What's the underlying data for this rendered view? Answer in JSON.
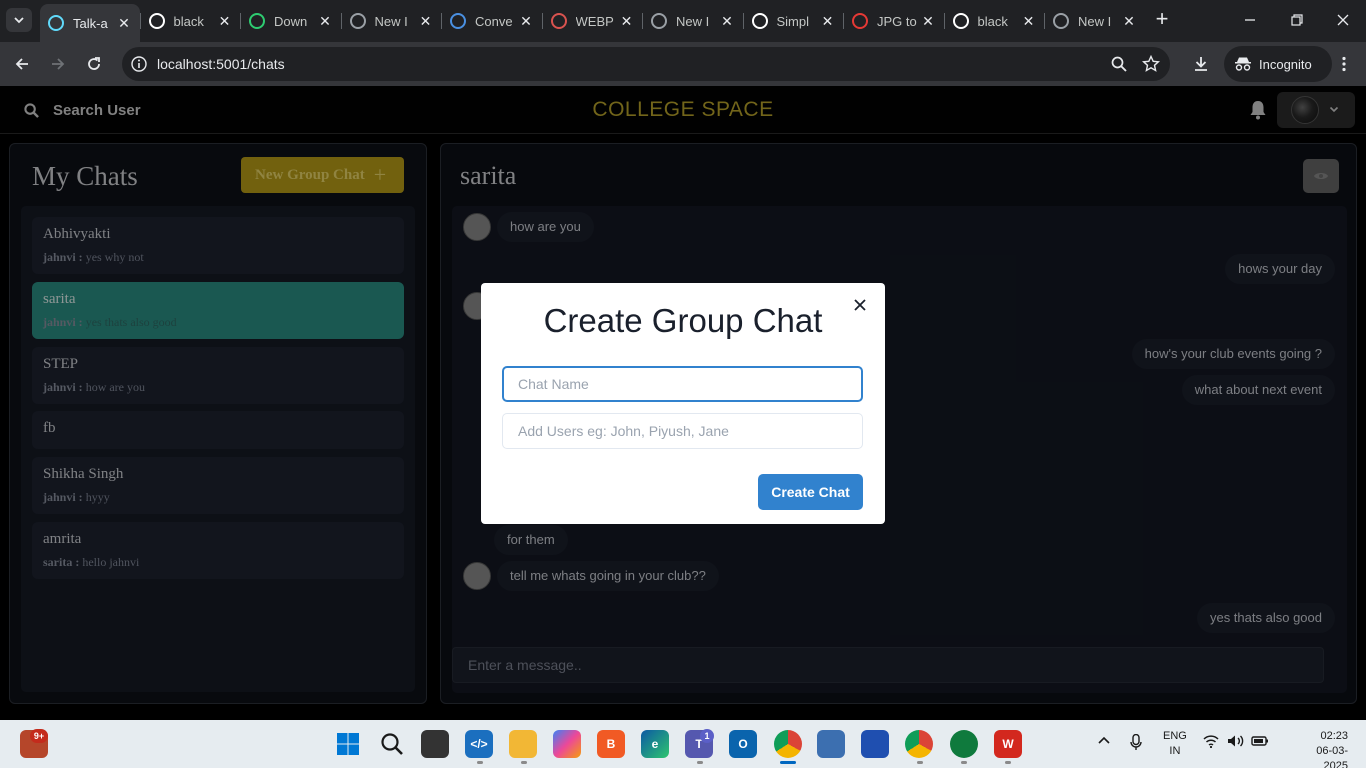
{
  "browser": {
    "tabs": [
      {
        "title": "Talk-a",
        "icon": "react-icon",
        "color": "#61dafb"
      },
      {
        "title": "black",
        "icon": "google-icon",
        "color": "#ffffff"
      },
      {
        "title": "Down",
        "icon": "px-icon",
        "color": "#2ecc71"
      },
      {
        "title": "New I",
        "icon": "incognito-icon",
        "color": "#9aa0a6"
      },
      {
        "title": "Conve",
        "icon": "diamond-icon",
        "color": "#4a90e2"
      },
      {
        "title": "WEBP",
        "icon": "cloud-icon",
        "color": "#d9534f"
      },
      {
        "title": "New I",
        "icon": "incognito-icon",
        "color": "#9aa0a6"
      },
      {
        "title": "Simpl",
        "icon": "google-icon",
        "color": "#ffffff"
      },
      {
        "title": "JPG to",
        "icon": "jpg-png-icon",
        "color": "#e53935"
      },
      {
        "title": "black",
        "icon": "google-icon",
        "color": "#ffffff"
      },
      {
        "title": "New I",
        "icon": "incognito-icon",
        "color": "#9aa0a6"
      }
    ],
    "url": "localhost:5001/chats",
    "incognito_label": "Incognito"
  },
  "app": {
    "search_label": "Search User",
    "brand": "COLLEGE SPACE",
    "brand_color": "#b8a32a"
  },
  "sidebar": {
    "title": "My Chats",
    "new_group_label": "New Group Chat",
    "new_group_plus": "+",
    "chats": [
      {
        "name": "Abhivyakti",
        "sender": "jahnvi :",
        "message": "yes why not",
        "selected": false
      },
      {
        "name": "sarita",
        "sender": "jahnvi :",
        "message": "yes thats also good",
        "selected": true
      },
      {
        "name": "STEP",
        "sender": "jahnvi :",
        "message": "how are you",
        "selected": false
      },
      {
        "name": "fb",
        "sender": "",
        "message": "",
        "selected": false
      },
      {
        "name": "Shikha Singh",
        "sender": "jahnvi :",
        "message": "hyyy",
        "selected": false
      },
      {
        "name": "amrita",
        "sender": "sarita :",
        "message": "hello jahnvi",
        "selected": false
      }
    ]
  },
  "chat": {
    "title": "sarita",
    "messages": [
      {
        "text": "how are you",
        "side": "left",
        "avatar": true
      },
      {
        "text": "hows your day",
        "side": "right"
      },
      {
        "text": "how's your club events going ?",
        "side": "right"
      },
      {
        "text": "what about next event",
        "side": "right"
      },
      {
        "text": "for them",
        "side": "left",
        "avatar": false
      },
      {
        "text": "tell me whats going in your club??",
        "side": "left",
        "avatar": true
      },
      {
        "text": "yes thats also good",
        "side": "right"
      }
    ],
    "input_placeholder": "Enter a message.."
  },
  "modal": {
    "title": "Create Group Chat",
    "chat_name_placeholder": "Chat Name",
    "add_users_placeholder": "Add Users eg: John, Piyush, Jane",
    "create_label": "Create Chat",
    "accent": "#3182ce"
  },
  "taskbar": {
    "badge": "9+",
    "teams_badge": "1",
    "lang_line1": "ENG",
    "lang_line2": "IN",
    "time": "02:23",
    "date": "06-03-2025"
  }
}
